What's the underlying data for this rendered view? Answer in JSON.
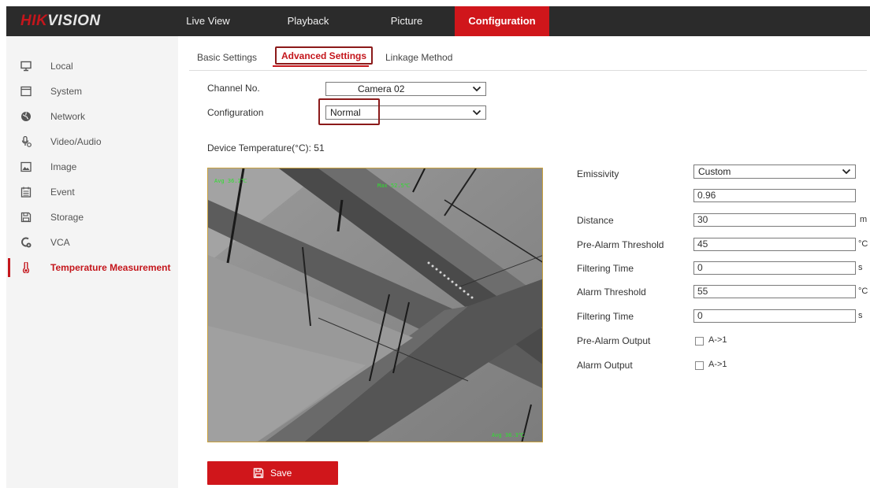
{
  "brand": {
    "part1": "HIK",
    "part2": "VISION"
  },
  "nav": [
    {
      "label": "Live View"
    },
    {
      "label": "Playback"
    },
    {
      "label": "Picture"
    },
    {
      "label": "Configuration",
      "active": true
    }
  ],
  "sidebar": {
    "items": [
      {
        "label": "Local",
        "icon": "monitor-icon"
      },
      {
        "label": "System",
        "icon": "window-icon"
      },
      {
        "label": "Network",
        "icon": "globe-icon"
      },
      {
        "label": "Video/Audio",
        "icon": "microphone-icon"
      },
      {
        "label": "Image",
        "icon": "image-icon"
      },
      {
        "label": "Event",
        "icon": "calendar-icon"
      },
      {
        "label": "Storage",
        "icon": "storage-icon"
      },
      {
        "label": "VCA",
        "icon": "vca-icon"
      },
      {
        "label": "Temperature Measurement",
        "icon": "thermometer-icon",
        "active": true
      }
    ]
  },
  "tabs": [
    {
      "label": "Basic Settings"
    },
    {
      "label": "Advanced Settings",
      "active": true
    },
    {
      "label": "Linkage Method"
    }
  ],
  "form": {
    "channel_label": "Channel No.",
    "channel_value": "Camera 02",
    "configuration_label": "Configuration",
    "configuration_value": "Normal",
    "device_temp": "Device Temperature(°C): 51"
  },
  "video_overlay": {
    "top_left": "Avg 36.1℃",
    "top_mid": "Max 52.5℃",
    "bottom_right": "Avg 36.3℃"
  },
  "params": {
    "emissivity_label": "Emissivity",
    "emissivity_mode": "Custom",
    "emissivity_value": "0.96",
    "distance_label": "Distance",
    "distance_value": "30",
    "distance_unit": "m",
    "prealarm_label": "Pre-Alarm Threshold",
    "prealarm_value": "45",
    "prealarm_unit": "°C",
    "filter1_label": "Filtering Time",
    "filter1_value": "0",
    "filter1_unit": "s",
    "alarm_label": "Alarm Threshold",
    "alarm_value": "55",
    "alarm_unit": "°C",
    "filter2_label": "Filtering Time",
    "filter2_value": "0",
    "filter2_unit": "s",
    "prealarm_output_label": "Pre-Alarm Output",
    "prealarm_output_option": "A->1",
    "alarm_output_label": "Alarm Output",
    "alarm_output_option": "A->1"
  },
  "save_label": "Save",
  "colors": {
    "accent": "#d0161b",
    "topbar": "#2b2b2b",
    "sidebar": "#f4f4f4",
    "highlight": "#8b1a1a"
  }
}
